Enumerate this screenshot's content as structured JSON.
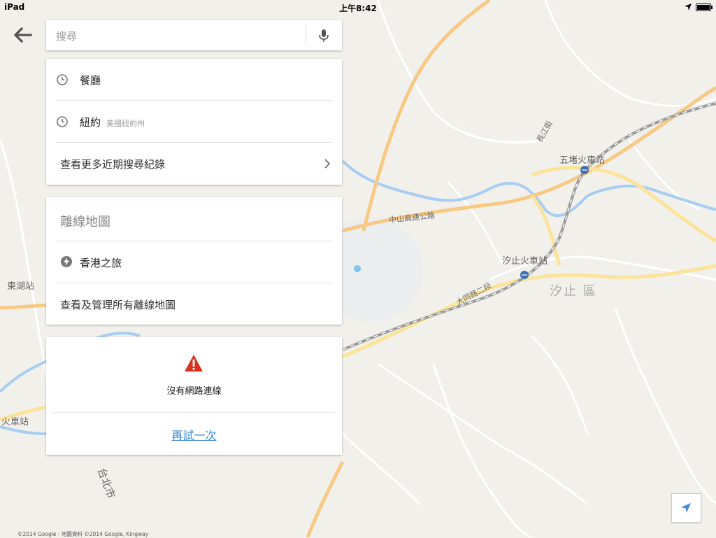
{
  "status_bar": {
    "carrier": "iPad",
    "time": "上午8:42",
    "battery_level": 1.0
  },
  "search": {
    "placeholder": "搜尋"
  },
  "recent": {
    "items": [
      {
        "label": "餐廳",
        "sub": ""
      },
      {
        "label": "紐約",
        "sub": "美國紐約州"
      }
    ],
    "more_label": "查看更多近期搜尋紀錄"
  },
  "offline_maps": {
    "title": "離線地圖",
    "items": [
      {
        "label": "香港之旅"
      }
    ],
    "manage_label": "查看及管理所有離線地圖"
  },
  "error": {
    "message": "沒有網路連線",
    "retry_label": "再試一次"
  },
  "map_labels": {
    "wudu_station": "五堵火車站",
    "xizhi_station": "汐止火車站",
    "xizhi_district": "汐止 區",
    "donghu_station": "東湖站",
    "train_station_left": "火車站",
    "taipei_city": "台北市",
    "zhongshan_hwy": "中山高速公路",
    "datong_rd": "大同路二段",
    "zhangjiang_st": "長江街"
  },
  "copyright": "©2014 Google - 地圖資料 ©2014 Google, Kingway",
  "colors": {
    "map_bg": "#f1efe9",
    "highway": "#f8c985",
    "major_road": "#fbe49a",
    "river": "#a7cdf2",
    "rail": "#9a9a9a",
    "link_blue": "#3a88d8",
    "warning_red": "#d9301f"
  }
}
